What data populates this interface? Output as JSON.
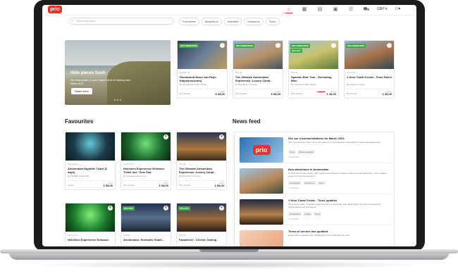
{
  "brand": {
    "logo_text": "prio",
    "accent": "#e5332a",
    "green": "#3caa3c"
  },
  "header": {
    "nav_icons": [
      "home-icon",
      "grid-icon",
      "document-icon",
      "ticket-icon",
      "list-icon",
      "cart-icon"
    ],
    "currency": "GBP ▾",
    "user_icon": "user-icon"
  },
  "search": {
    "placeholder": "Search product",
    "chips": [
      "Favourites",
      "Attractions",
      "Activities",
      "Museums",
      "Tours"
    ]
  },
  "hero": {
    "title": "Hide pieces fresh",
    "subtitle": "All creat plans in your hands start of making any cities stuff",
    "button": "Read more"
  },
  "top_cards": [
    {
      "category": "MUSEUM",
      "title": "Rembrandt Moon van Reijn Kalpel(museum)",
      "by": "By Rembrandt Online Kalpel.",
      "duration": "90 minutes",
      "from": "From",
      "price": "£ 38,00",
      "badge": "RECOMMENDED",
      "badge2": ""
    },
    {
      "category": "TOUR",
      "title": "The Ultimate Amsterdam Experience: Luxury Canal...",
      "by": "By Blue Boat Company",
      "duration": "120 minutes",
      "from": "From",
      "price": "£ 58,00",
      "badge": "RECOMMENDED",
      "badge2": ""
    },
    {
      "category": "TOUR",
      "title": "Spanish Bike Tour - Excluding Bike",
      "by": "By Openbaars Bike Rental",
      "duration": "120 minutes",
      "from": "From",
      "old": "£ 56,00",
      "price": "£ 48,00",
      "badge": "RECOMMENDED",
      "badge2": "20% OFF"
    },
    {
      "category": "ACTIVITY",
      "title": "1 Hour Canal Cruise - From Rokin",
      "by": "By Rederij D Canal",
      "duration": "60 minutes",
      "from": "From",
      "price": "£ 38,00",
      "badge": "RECOMMENDED",
      "badge2": ""
    }
  ],
  "favourites": {
    "title": "Favourites",
    "cards": [
      {
        "category": "FESTIVAL",
        "title": "Amsterdam Nightlife Ticket (2 days)",
        "by": "By Nightlife Amsterdam",
        "duration": "2 days",
        "from": "From",
        "price": "£ 58,00",
        "badge": ""
      },
      {
        "category": "ACTIVITY",
        "title": "Heineken Experience Entrance Ticket Incl. Time Slot",
        "by": "By Heineken Experience",
        "duration": "100 minutes",
        "from": "From",
        "price": "£ 58,00",
        "badge": ""
      },
      {
        "category": "TOUR",
        "title": "The Ultimate Amsterdam Experience: Luxury Canal...",
        "by": "By Blue Boat Company",
        "duration": "120 minutes",
        "from": "From",
        "price": "£ 58,00",
        "badge": ""
      },
      {
        "category": "ACTIVITY",
        "title": "Heineken Experience Entrance",
        "by": "",
        "duration": "",
        "from": "",
        "price": "",
        "badge": ""
      },
      {
        "category": "TOUR",
        "title": "Amsterdam: Romantic Small...",
        "by": "",
        "duration": "",
        "from": "",
        "price": "",
        "badge": "20% OFF"
      },
      {
        "category": "TOUR",
        "title": "Paradeiser - Cheese Tasting",
        "by": "",
        "duration": "",
        "from": "",
        "price": "",
        "badge": "20% OFF"
      }
    ]
  },
  "news": {
    "title": "News feed",
    "items": [
      {
        "title": "See our recommendations for March 2020",
        "desc": "Sed ut perspiciatis unde omnis iste natus error sit voluptatem accusantium doloremque laudantium.",
        "tags": [
          "Tours",
          "Recommended"
        ],
        "date": "27/02/2020"
      },
      {
        "title": "New attractions in Amsterdam",
        "desc": "Ut enim ad minima veniam, quis nostrum exercitationem ullam corporis suscipit laboriosam, nisi ut aliquid ex ea commodi consequatur?",
        "tags": [
          "Amsterdam",
          "Attractions",
          "Tours"
        ],
        "date": "17/02/2020"
      },
      {
        "title": "1 Hour Canal Cruise - Tours updates",
        "desc": "Nemo enim ipsam voluptatem quia voluptas sit aspernatur aut odit aut fugit, sed quia consequuntur magni dolores eos qui ratione.",
        "tags": [
          "Amsterdam",
          "Cruise",
          "Tours"
        ],
        "date": "12/02/2020"
      },
      {
        "title": "Terms of service has updated",
        "desc": "Neque porro quisquam est, qui dolorem ipsum quia dolor sit amet.",
        "tags": [],
        "date": ""
      }
    ]
  }
}
